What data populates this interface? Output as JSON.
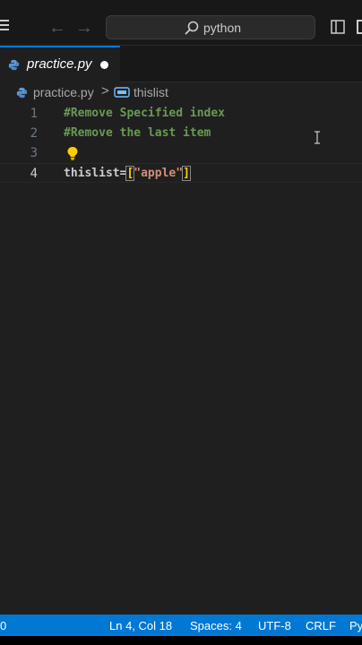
{
  "titlebar": {
    "command_center_text": "python",
    "back_arrow": "←",
    "forward_arrow": "→"
  },
  "tab": {
    "label": "practice.py",
    "modified": true
  },
  "breadcrumb": {
    "file": "practice.py",
    "separator": ">",
    "symbol": "thislist"
  },
  "editor": {
    "line_numbers": [
      "1",
      "2",
      "3",
      "4"
    ],
    "lines": [
      {
        "comment": "#Remove Specified index"
      },
      {
        "comment": "#Remove the last item"
      },
      {
        "empty": ""
      },
      {
        "var": "thislist",
        "op": "=",
        "open": "[",
        "str": "\"apple\"",
        "close": "]"
      }
    ],
    "active_line": 4
  },
  "statusbar": {
    "problems": "0",
    "position": "Ln 4, Col 18",
    "spaces": "Spaces: 4",
    "encoding": "UTF-8",
    "eol": "CRLF",
    "language": "Py"
  },
  "colors": {
    "accent": "#0078d4",
    "comment": "#6a9955",
    "string": "#ce9178",
    "bracket": "#ffd700",
    "editor_bg": "#1f1f1f"
  },
  "icons": {
    "menu": "hamburger-icon",
    "search": "search-icon",
    "python": "python-file-icon",
    "variable": "variable-symbol-icon",
    "lightbulb": "lightbulb-icon",
    "layout": "layout-sidebar-icon"
  }
}
